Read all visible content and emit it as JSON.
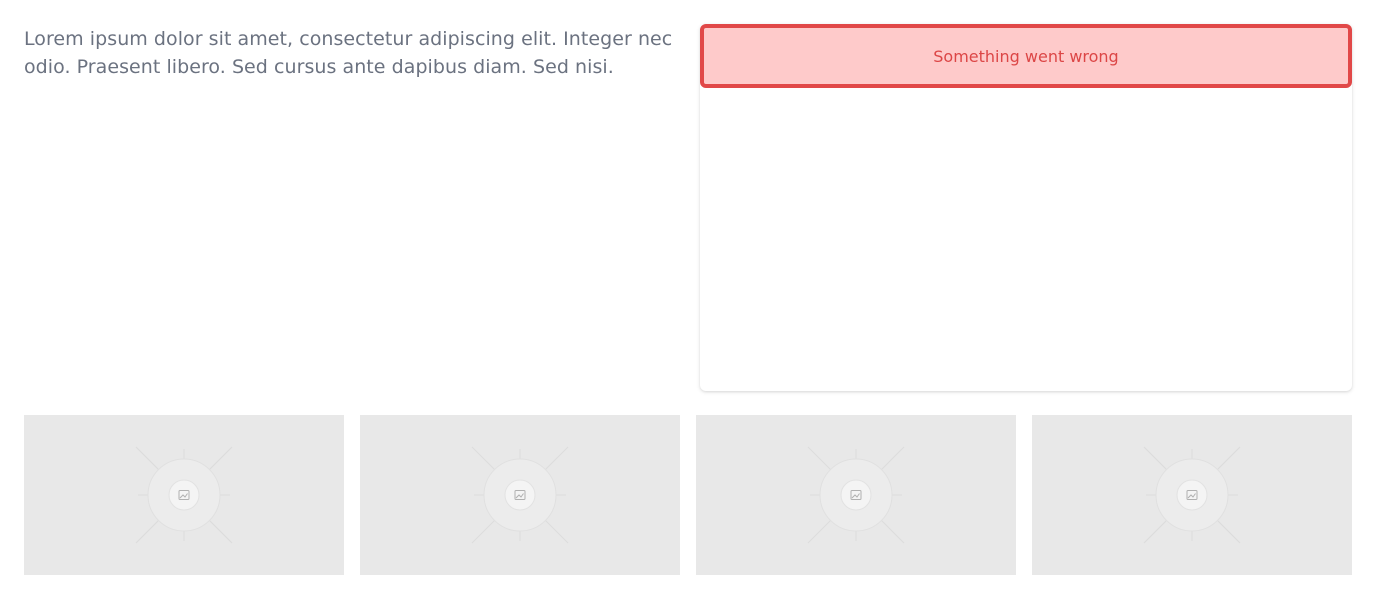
{
  "intro": {
    "text": "Lorem ipsum dolor sit amet, consectetur adipiscing elit. Integer nec odio. Praesent libero. Sed cursus ante dapibus diam. Sed nisi."
  },
  "card": {
    "error_message": "Something went wrong"
  },
  "thumbnails": [
    {
      "icon": "image-placeholder-icon"
    },
    {
      "icon": "image-placeholder-icon"
    },
    {
      "icon": "image-placeholder-icon"
    },
    {
      "icon": "image-placeholder-icon"
    }
  ],
  "colors": {
    "text": "#6b7280",
    "alert_bg": "#fecaca",
    "alert_border": "#e14848",
    "alert_text": "#dc4646",
    "placeholder_bg": "#e8e8e8"
  }
}
